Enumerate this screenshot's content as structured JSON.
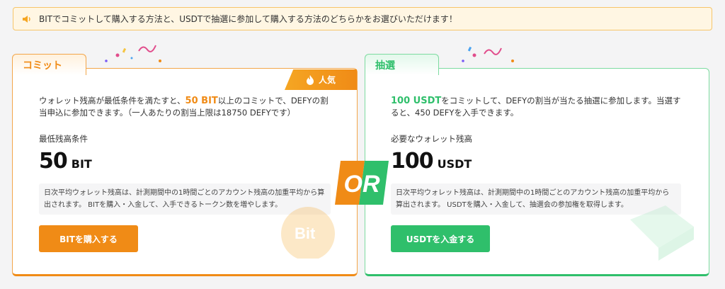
{
  "notice": {
    "text": "BITでコミットして購入する方法と、USDTで抽選に参加して購入する方法のどちらかをお選びいただけます！",
    "icon": "speaker-icon"
  },
  "commit": {
    "tab_label": "コミット",
    "badge_label": "人気",
    "desc_prefix": "ウォレット残高が最低条件を満たすと、",
    "desc_highlight": "50 BIT",
    "desc_suffix": "以上のコミットで、DEFYの割当申込に参加できます。（一人あたりの割当上限は18750 DEFYです）",
    "label": "最低残高条件",
    "value": "50",
    "unit": "BIT",
    "note": "日次平均ウォレット残高は、計測期間中の1時間ごとのアカウント残高の加重平均から算出されます。 BITを購入・入金して、入手できるトークン数を増やします。",
    "button_label": "BITを購入する",
    "watermark": "Bit",
    "accent": "#f08b16"
  },
  "lottery": {
    "tab_label": "抽選",
    "desc_highlight": "100 USDT",
    "desc_suffix": "をコミットして、DEFYの割当が当たる抽選に参加します。当選すると、450 DEFYを入手できます。",
    "label": "必要なウォレット残高",
    "value": "100",
    "unit": "USDT",
    "note": "日次平均ウォレット残高は、計測期間中の1時間ごとのアカウント残高の加重平均から算出されます。 USDTを購入・入金して、抽選会の参加権を取得します。",
    "button_label": "USDTを入金する",
    "accent": "#2fbf6b"
  },
  "or_badge": "OR"
}
